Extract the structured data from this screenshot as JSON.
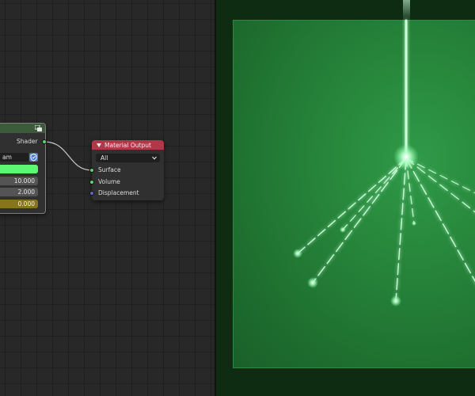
{
  "node_editor": {
    "emission_node": {
      "output_socket_label": "Shader",
      "datablock_name": "am",
      "color_hex": "#5df773",
      "values": [
        "10.000",
        "2.000",
        "0.000"
      ]
    },
    "material_output_node": {
      "title": "Material Output",
      "target": "All",
      "inputs": [
        "Surface",
        "Volume",
        "Displacement"
      ]
    }
  },
  "colors": {
    "shader_socket": "#5fd56a",
    "vector_socket": "#6363c7",
    "output_header": "#b03848",
    "emission_header": "#3b5b3b",
    "strength_bar": "#867619",
    "viewport_glow": "#7dffa0"
  },
  "icons": {
    "emission_node": "node-tree-icon",
    "datablock": "fake-user-shield-icon",
    "output_collapse": "triangle-down-icon",
    "dropdown": "chevron-down-icon"
  }
}
